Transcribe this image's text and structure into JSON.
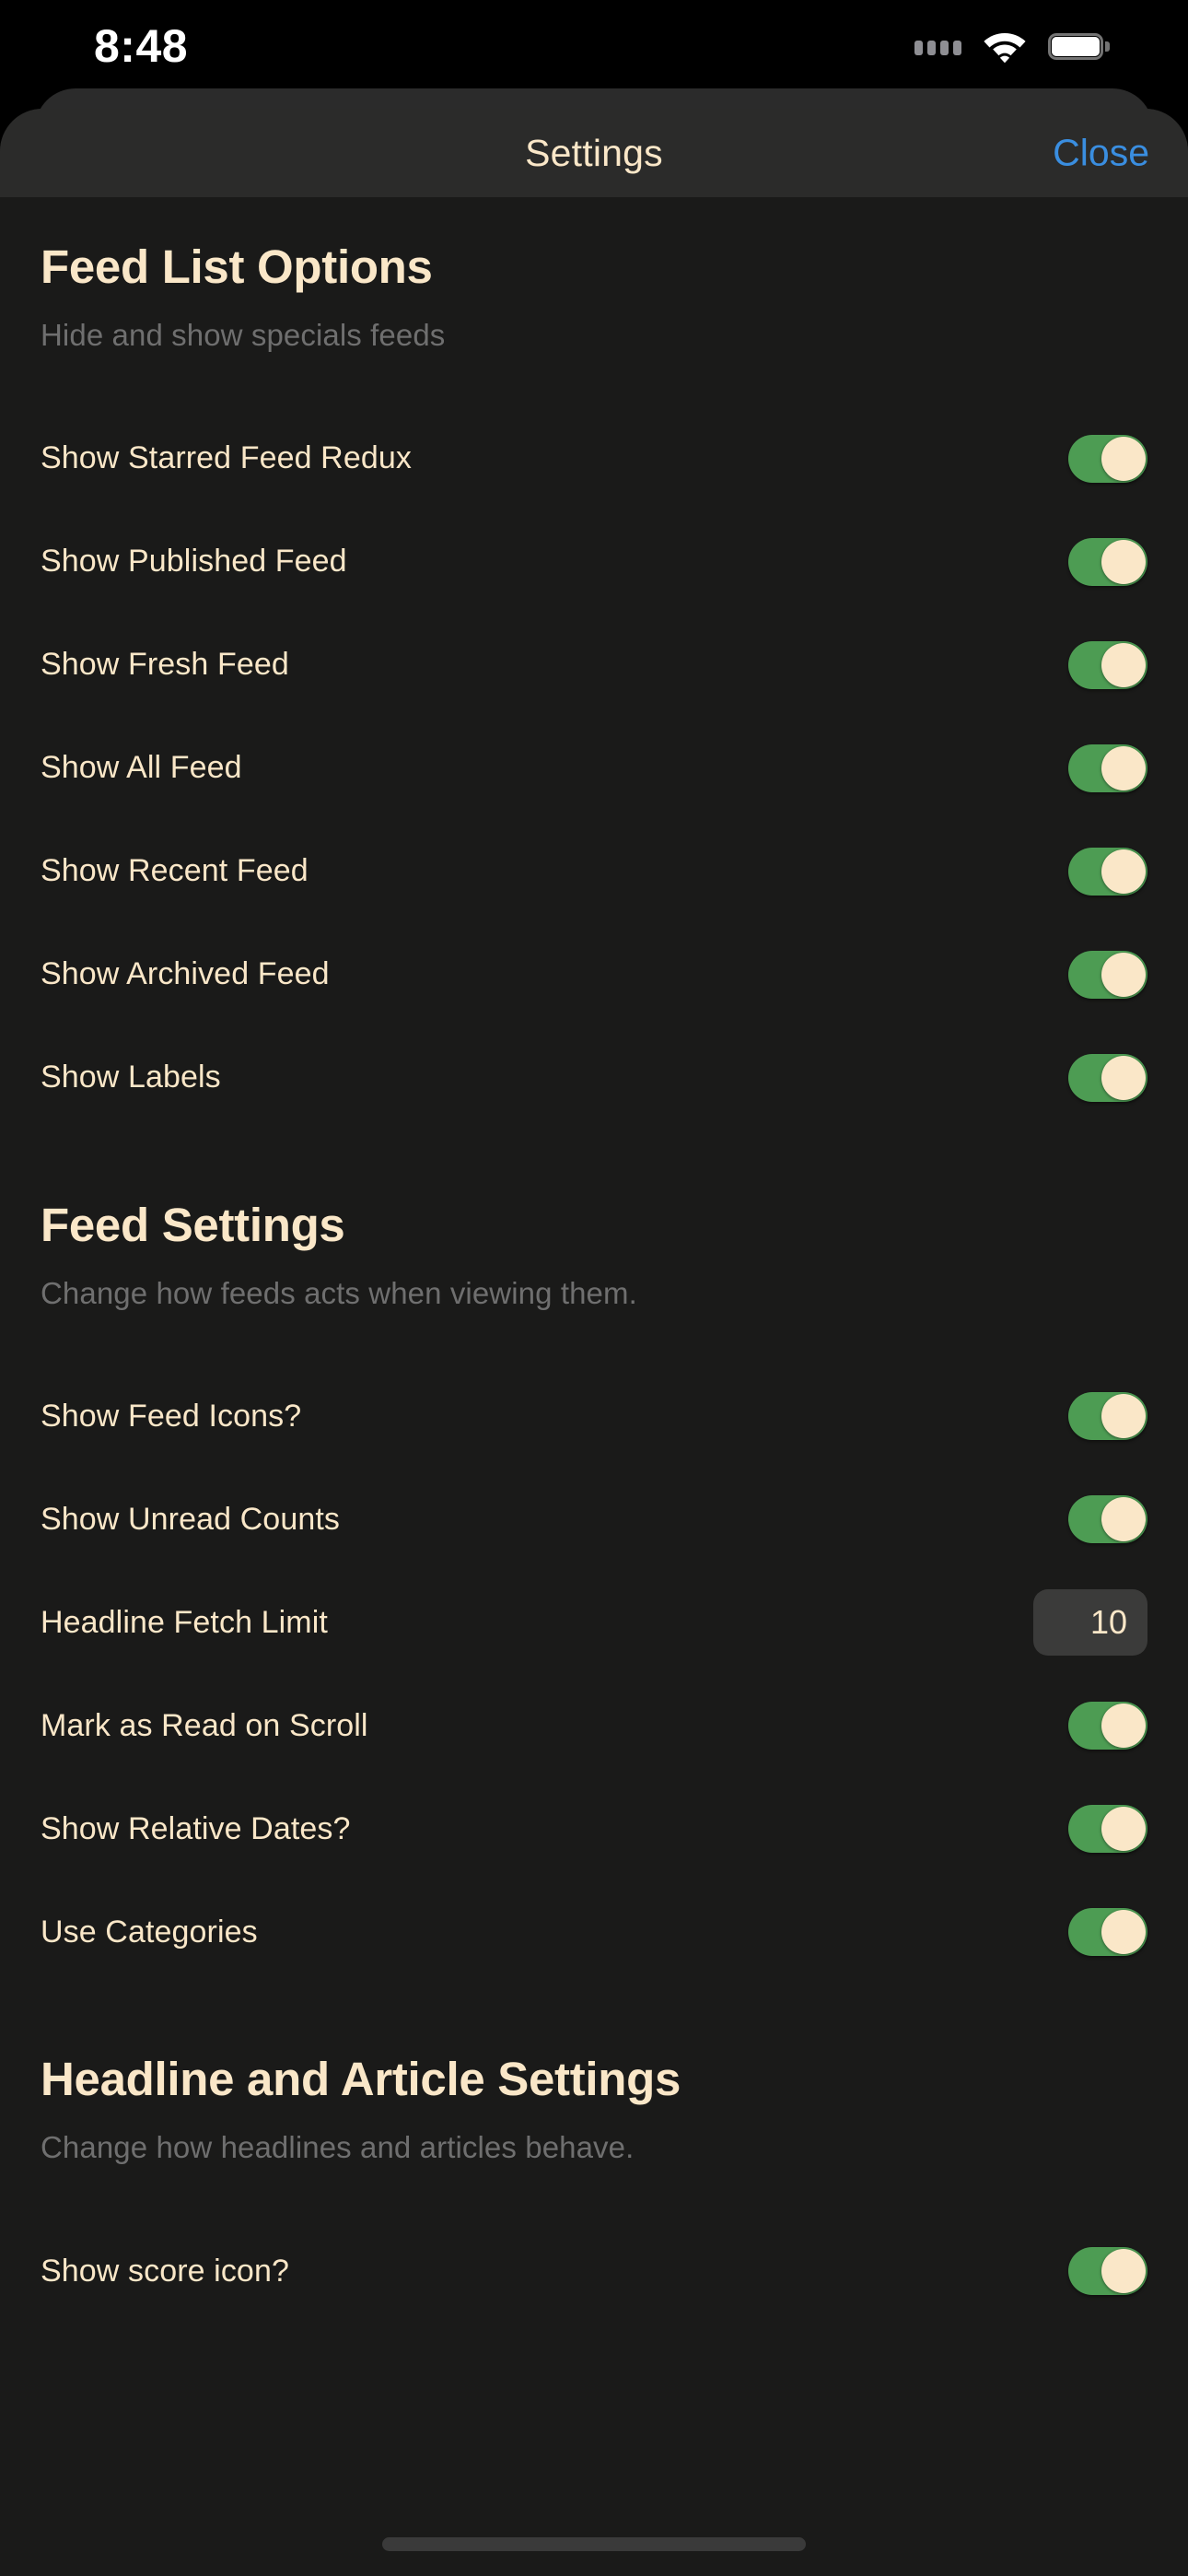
{
  "status_bar": {
    "time": "8:48",
    "cellular_icon": "cellular-dots-icon",
    "wifi_icon": "wifi-icon",
    "battery_icon": "battery-icon"
  },
  "navbar": {
    "title": "Settings",
    "close_label": "Close"
  },
  "colors": {
    "accent_cream": "#fae7c8",
    "toggle_on_green": "#4d9c53",
    "link_blue": "#3a8ee0",
    "sheet_background": "#1a1a19",
    "navbar_background": "#2b2b2a",
    "muted_text": "#6f6f6f",
    "field_background": "#3b3b3a"
  },
  "sections": [
    {
      "title": "Feed List Options",
      "description": "Hide and show specials feeds",
      "rows": [
        {
          "label": "Show Starred Feed Redux",
          "control": "toggle",
          "value": "on"
        },
        {
          "label": "Show Published Feed",
          "control": "toggle",
          "value": "on"
        },
        {
          "label": "Show Fresh Feed",
          "control": "toggle",
          "value": "on"
        },
        {
          "label": "Show All Feed",
          "control": "toggle",
          "value": "on"
        },
        {
          "label": "Show Recent Feed",
          "control": "toggle",
          "value": "on"
        },
        {
          "label": "Show Archived Feed",
          "control": "toggle",
          "value": "on"
        },
        {
          "label": "Show Labels",
          "control": "toggle",
          "value": "on"
        }
      ]
    },
    {
      "title": "Feed Settings",
      "description": "Change how feeds acts when viewing them.",
      "rows": [
        {
          "label": "Show Feed Icons?",
          "control": "toggle",
          "value": "on"
        },
        {
          "label": "Show Unread Counts",
          "control": "toggle",
          "value": "on"
        },
        {
          "label": "Headline Fetch Limit",
          "control": "number",
          "value": "10"
        },
        {
          "label": "Mark as Read on Scroll",
          "control": "toggle",
          "value": "on"
        },
        {
          "label": "Show Relative Dates?",
          "control": "toggle",
          "value": "on"
        },
        {
          "label": "Use Categories",
          "control": "toggle",
          "value": "on"
        }
      ]
    },
    {
      "title": "Headline and Article Settings",
      "description": "Change how headlines and articles behave.",
      "rows": [
        {
          "label": "Show score icon?",
          "control": "toggle",
          "value": "on"
        }
      ]
    }
  ]
}
